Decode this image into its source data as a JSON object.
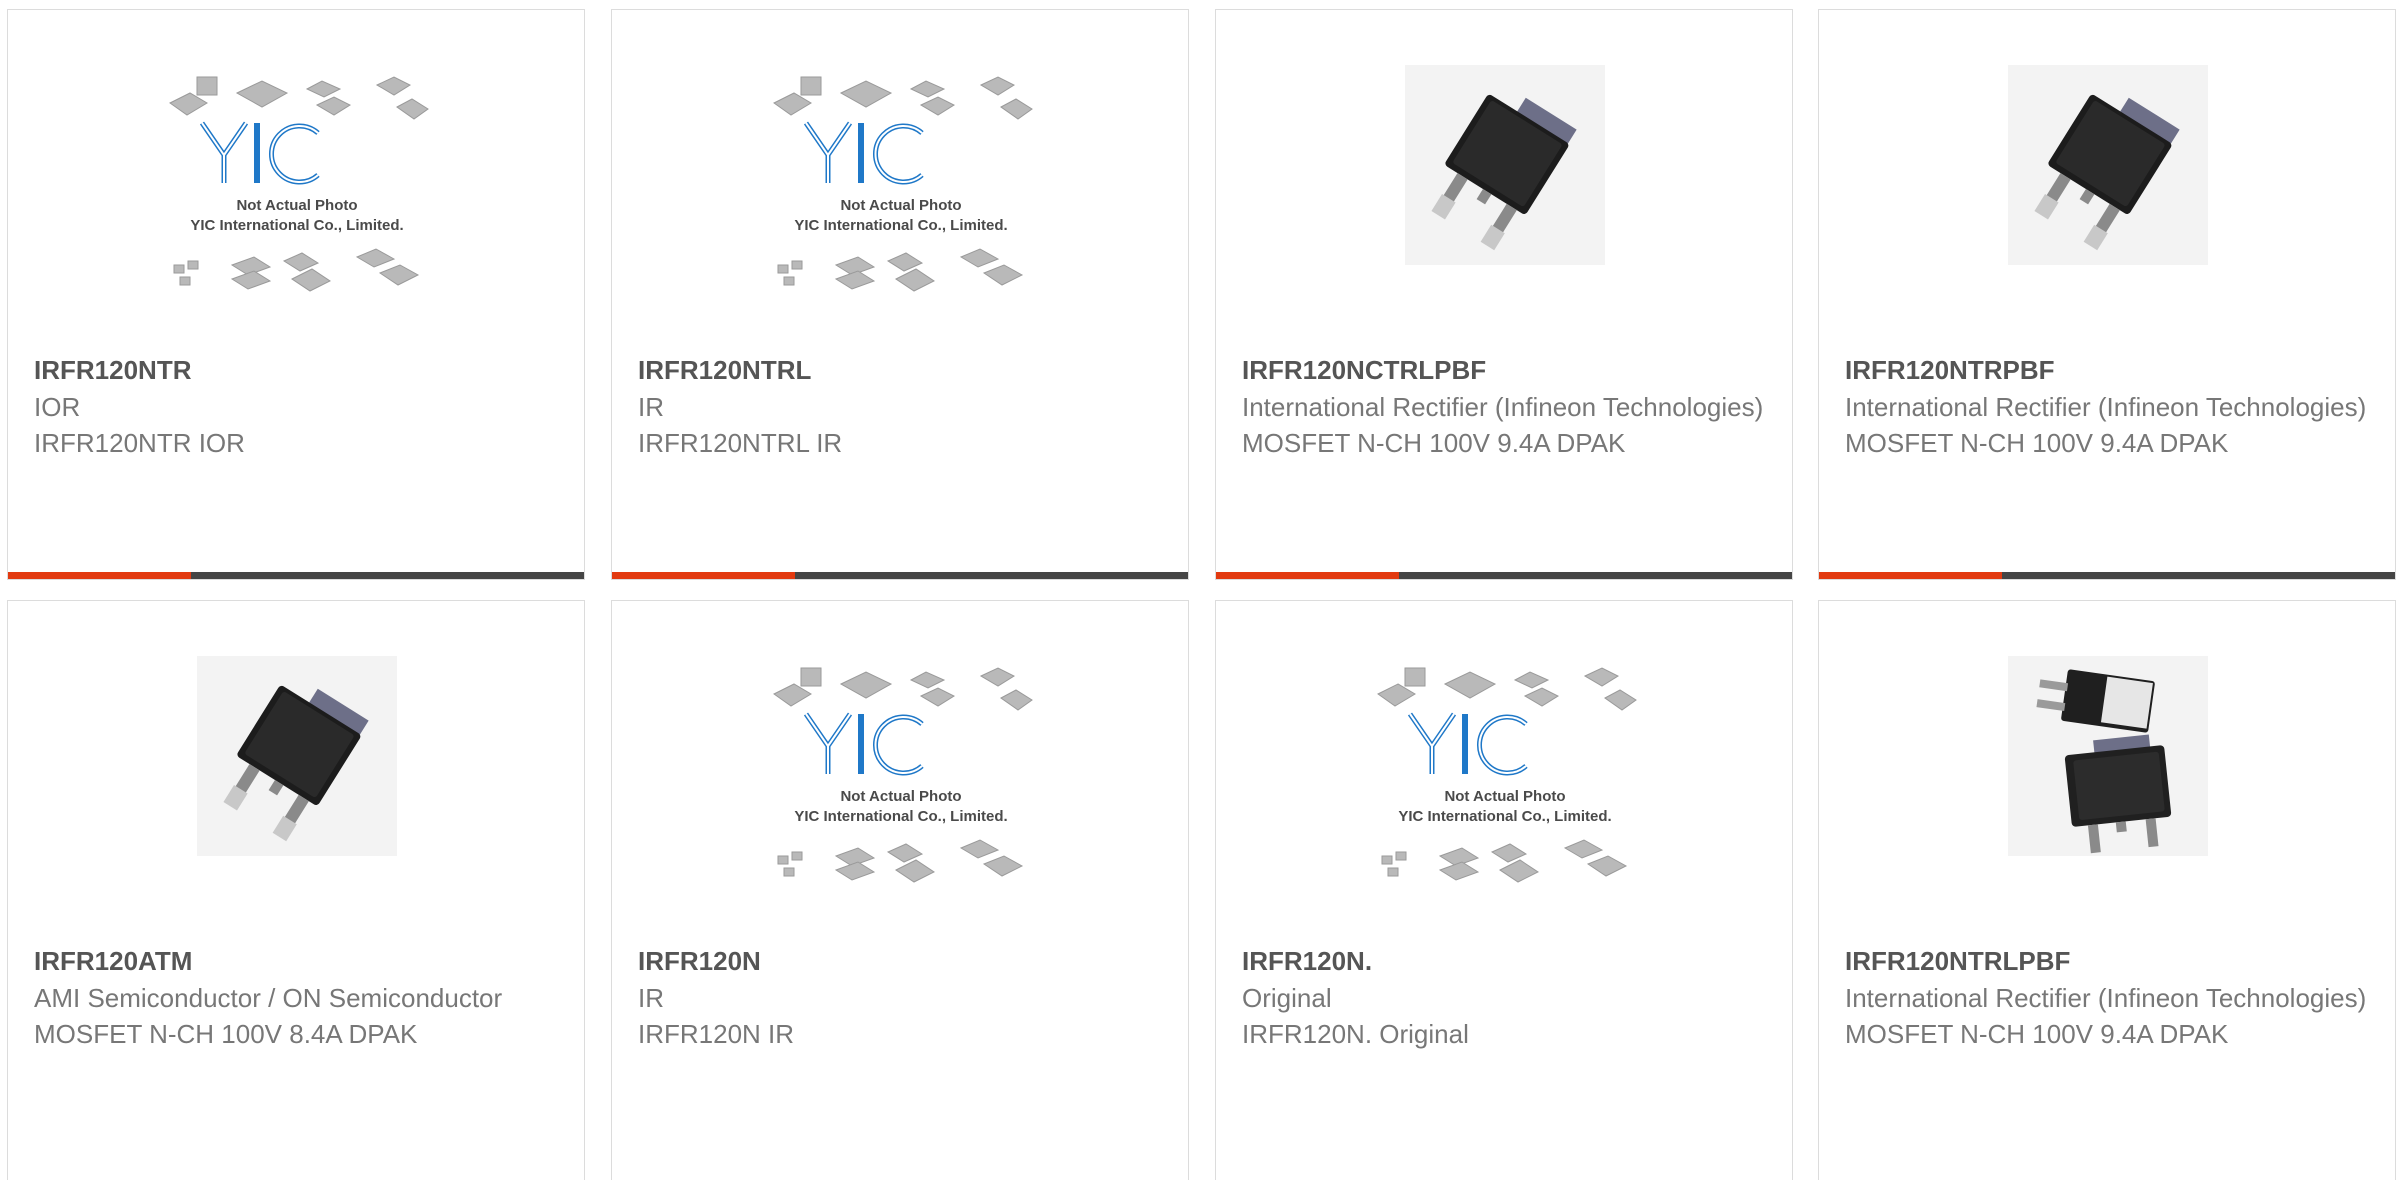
{
  "products": [
    {
      "part_number": "IRFR120NTR",
      "manufacturer": "IOR",
      "description": "IRFR120NTR IOR",
      "image": "placeholder-yic"
    },
    {
      "part_number": "IRFR120NTRL",
      "manufacturer": "IR",
      "description": "IRFR120NTRL IR",
      "image": "placeholder-yic"
    },
    {
      "part_number": "IRFR120NCTRLPBF",
      "manufacturer": "International Rectifier (Infineon Technologies)",
      "description": "MOSFET N-CH 100V 9.4A DPAK",
      "image": "dpak-photo"
    },
    {
      "part_number": "IRFR120NTRPBF",
      "manufacturer": "International Rectifier (Infineon Technologies)",
      "description": "MOSFET N-CH 100V 9.4A DPAK",
      "image": "dpak-photo"
    },
    {
      "part_number": "IRFR120ATM",
      "manufacturer": "AMI Semiconductor / ON Semiconductor",
      "description": "MOSFET N-CH 100V 8.4A DPAK",
      "image": "dpak-photo"
    },
    {
      "part_number": "IRFR120N",
      "manufacturer": "IR",
      "description": "IRFR120N IR",
      "image": "placeholder-yic"
    },
    {
      "part_number": "IRFR120N.",
      "manufacturer": "Original",
      "description": "IRFR120N. Original",
      "image": "placeholder-yic"
    },
    {
      "part_number": "IRFR120NTRLPBF",
      "manufacturer": "International Rectifier (Infineon Technologies)",
      "description": "MOSFET N-CH 100V 9.4A DPAK",
      "image": "dpak-pair-photo"
    }
  ],
  "placeholder": {
    "line1": "Not Actual Photo",
    "line2": "YIC International Co., Limited."
  },
  "colors": {
    "accent_bar": "#e23a10",
    "dark_bar": "#454545",
    "yic_logo_blue": "#1f78c8"
  }
}
